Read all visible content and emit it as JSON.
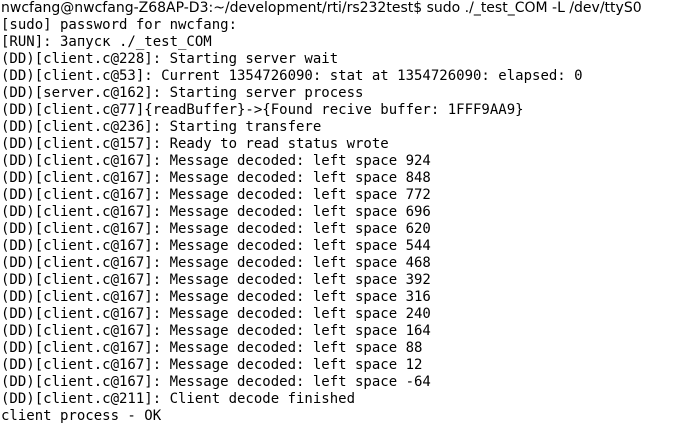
{
  "terminal": {
    "prompt": {
      "text": "nwcfang@nwcfang-Z68AP-D3:~/development/rti/rs232test$ sudo ./_test_COM -L /dev/ttyS0"
    },
    "lines": [
      "[sudo] password for nwcfang:",
      "[RUN]: Запуск ./_test_COM",
      "(DD)[client.c@228]: Starting server wait",
      "(DD)[client.c@53]: Current 1354726090: stat at 1354726090: elapsed: 0",
      "(DD)[server.c@162]: Starting server process",
      "(DD)[client.c@77]{readBuffer}->{Found recive buffer: 1FFF9AA9}",
      "(DD)[client.c@236]: Starting transfere",
      "(DD)[client.c@157]: Ready to read status wrote",
      "(DD)[client.c@167]: Message decoded: left space 924",
      "(DD)[client.c@167]: Message decoded: left space 848",
      "(DD)[client.c@167]: Message decoded: left space 772",
      "(DD)[client.c@167]: Message decoded: left space 696",
      "(DD)[client.c@167]: Message decoded: left space 620",
      "(DD)[client.c@167]: Message decoded: left space 544",
      "(DD)[client.c@167]: Message decoded: left space 468",
      "(DD)[client.c@167]: Message decoded: left space 392",
      "(DD)[client.c@167]: Message decoded: left space 316",
      "(DD)[client.c@167]: Message decoded: left space 240",
      "(DD)[client.c@167]: Message decoded: left space 164",
      "(DD)[client.c@167]: Message decoded: left space 88",
      "(DD)[client.c@167]: Message decoded: left space 12",
      "(DD)[client.c@167]: Message decoded: left space -64",
      "(DD)[client.c@211]: Client decode finished",
      "client process - OK"
    ]
  }
}
